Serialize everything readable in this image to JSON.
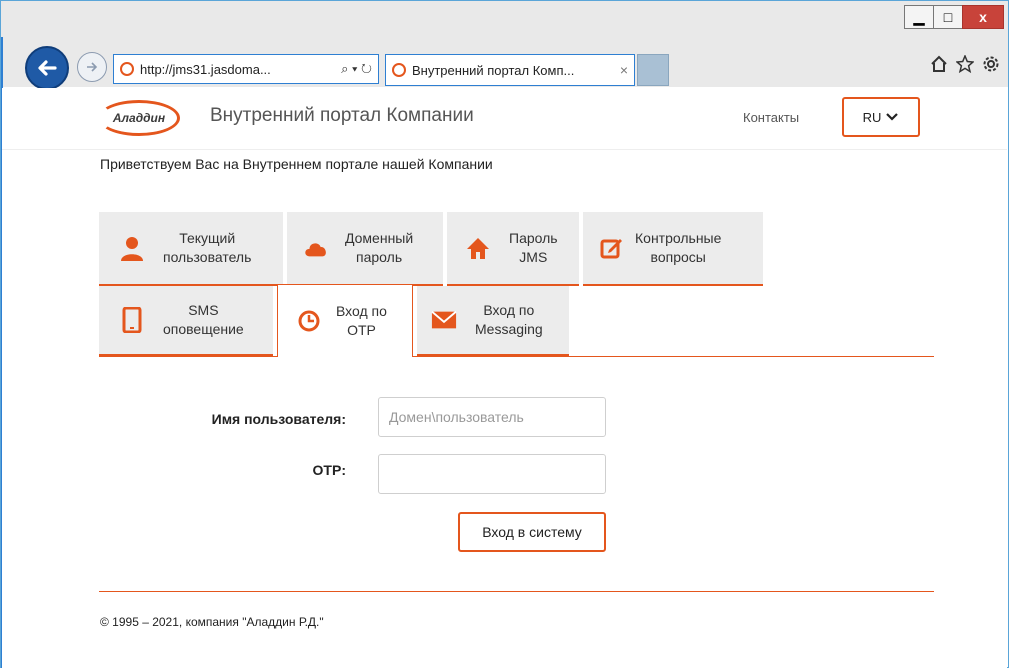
{
  "browser": {
    "address_url": "http://jms31.jasdoma...",
    "address_controls": "⌕ ▾ ↻",
    "tab_title": "Внутренний портал Комп...",
    "tab_close": "×",
    "win_minimize": "▁",
    "win_maximize": "□",
    "win_close": "x"
  },
  "header": {
    "logo_text": "Аладдин",
    "portal_title": "Внутренний портал Компании",
    "contacts_label": "Контакты",
    "lang_label": "RU"
  },
  "welcome": "Приветствуем Вас на Внутреннем портале нашей Компании",
  "tabs": [
    {
      "line1": "Текущий",
      "line2": "пользователь",
      "icon": "user-icon"
    },
    {
      "line1": "Доменный",
      "line2": "пароль",
      "icon": "cloud-icon"
    },
    {
      "line1": "Пароль",
      "line2": "JMS",
      "icon": "home-icon"
    },
    {
      "line1": "Контрольные",
      "line2": "вопросы",
      "icon": "edit-icon"
    },
    {
      "line1": "SMS",
      "line2": "оповещение",
      "icon": "phone-icon"
    },
    {
      "line1": "Вход по",
      "line2": "OTP",
      "icon": "clock-icon"
    },
    {
      "line1": "Вход по",
      "line2": "Messaging",
      "icon": "envelope-icon"
    }
  ],
  "form": {
    "username_label": "Имя пользователя:",
    "username_placeholder": "Домен\\пользователь",
    "otp_label": "OTP:",
    "login_button": "Вход в систему"
  },
  "footer": "© 1995 – 2021, компания \"Аладдин Р.Д.\"",
  "colors": {
    "accent": "#e4561d",
    "tab_bg": "#ececec"
  }
}
